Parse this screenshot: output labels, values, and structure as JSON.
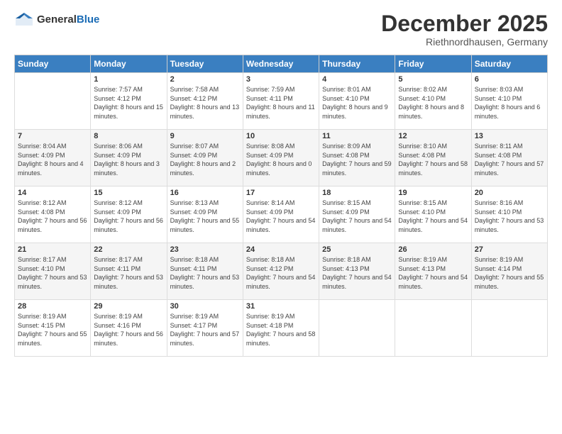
{
  "logo": {
    "general": "General",
    "blue": "Blue"
  },
  "title": "December 2025",
  "subtitle": "Riethnordhausen, Germany",
  "days_header": [
    "Sunday",
    "Monday",
    "Tuesday",
    "Wednesday",
    "Thursday",
    "Friday",
    "Saturday"
  ],
  "weeks": [
    [
      {
        "day": "",
        "sunrise": "",
        "sunset": "",
        "daylight": ""
      },
      {
        "day": "1",
        "sunrise": "Sunrise: 7:57 AM",
        "sunset": "Sunset: 4:12 PM",
        "daylight": "Daylight: 8 hours and 15 minutes."
      },
      {
        "day": "2",
        "sunrise": "Sunrise: 7:58 AM",
        "sunset": "Sunset: 4:12 PM",
        "daylight": "Daylight: 8 hours and 13 minutes."
      },
      {
        "day": "3",
        "sunrise": "Sunrise: 7:59 AM",
        "sunset": "Sunset: 4:11 PM",
        "daylight": "Daylight: 8 hours and 11 minutes."
      },
      {
        "day": "4",
        "sunrise": "Sunrise: 8:01 AM",
        "sunset": "Sunset: 4:10 PM",
        "daylight": "Daylight: 8 hours and 9 minutes."
      },
      {
        "day": "5",
        "sunrise": "Sunrise: 8:02 AM",
        "sunset": "Sunset: 4:10 PM",
        "daylight": "Daylight: 8 hours and 8 minutes."
      },
      {
        "day": "6",
        "sunrise": "Sunrise: 8:03 AM",
        "sunset": "Sunset: 4:10 PM",
        "daylight": "Daylight: 8 hours and 6 minutes."
      }
    ],
    [
      {
        "day": "7",
        "sunrise": "Sunrise: 8:04 AM",
        "sunset": "Sunset: 4:09 PM",
        "daylight": "Daylight: 8 hours and 4 minutes."
      },
      {
        "day": "8",
        "sunrise": "Sunrise: 8:06 AM",
        "sunset": "Sunset: 4:09 PM",
        "daylight": "Daylight: 8 hours and 3 minutes."
      },
      {
        "day": "9",
        "sunrise": "Sunrise: 8:07 AM",
        "sunset": "Sunset: 4:09 PM",
        "daylight": "Daylight: 8 hours and 2 minutes."
      },
      {
        "day": "10",
        "sunrise": "Sunrise: 8:08 AM",
        "sunset": "Sunset: 4:09 PM",
        "daylight": "Daylight: 8 hours and 0 minutes."
      },
      {
        "day": "11",
        "sunrise": "Sunrise: 8:09 AM",
        "sunset": "Sunset: 4:08 PM",
        "daylight": "Daylight: 7 hours and 59 minutes."
      },
      {
        "day": "12",
        "sunrise": "Sunrise: 8:10 AM",
        "sunset": "Sunset: 4:08 PM",
        "daylight": "Daylight: 7 hours and 58 minutes."
      },
      {
        "day": "13",
        "sunrise": "Sunrise: 8:11 AM",
        "sunset": "Sunset: 4:08 PM",
        "daylight": "Daylight: 7 hours and 57 minutes."
      }
    ],
    [
      {
        "day": "14",
        "sunrise": "Sunrise: 8:12 AM",
        "sunset": "Sunset: 4:08 PM",
        "daylight": "Daylight: 7 hours and 56 minutes."
      },
      {
        "day": "15",
        "sunrise": "Sunrise: 8:12 AM",
        "sunset": "Sunset: 4:09 PM",
        "daylight": "Daylight: 7 hours and 56 minutes."
      },
      {
        "day": "16",
        "sunrise": "Sunrise: 8:13 AM",
        "sunset": "Sunset: 4:09 PM",
        "daylight": "Daylight: 7 hours and 55 minutes."
      },
      {
        "day": "17",
        "sunrise": "Sunrise: 8:14 AM",
        "sunset": "Sunset: 4:09 PM",
        "daylight": "Daylight: 7 hours and 54 minutes."
      },
      {
        "day": "18",
        "sunrise": "Sunrise: 8:15 AM",
        "sunset": "Sunset: 4:09 PM",
        "daylight": "Daylight: 7 hours and 54 minutes."
      },
      {
        "day": "19",
        "sunrise": "Sunrise: 8:15 AM",
        "sunset": "Sunset: 4:10 PM",
        "daylight": "Daylight: 7 hours and 54 minutes."
      },
      {
        "day": "20",
        "sunrise": "Sunrise: 8:16 AM",
        "sunset": "Sunset: 4:10 PM",
        "daylight": "Daylight: 7 hours and 53 minutes."
      }
    ],
    [
      {
        "day": "21",
        "sunrise": "Sunrise: 8:17 AM",
        "sunset": "Sunset: 4:10 PM",
        "daylight": "Daylight: 7 hours and 53 minutes."
      },
      {
        "day": "22",
        "sunrise": "Sunrise: 8:17 AM",
        "sunset": "Sunset: 4:11 PM",
        "daylight": "Daylight: 7 hours and 53 minutes."
      },
      {
        "day": "23",
        "sunrise": "Sunrise: 8:18 AM",
        "sunset": "Sunset: 4:11 PM",
        "daylight": "Daylight: 7 hours and 53 minutes."
      },
      {
        "day": "24",
        "sunrise": "Sunrise: 8:18 AM",
        "sunset": "Sunset: 4:12 PM",
        "daylight": "Daylight: 7 hours and 54 minutes."
      },
      {
        "day": "25",
        "sunrise": "Sunrise: 8:18 AM",
        "sunset": "Sunset: 4:13 PM",
        "daylight": "Daylight: 7 hours and 54 minutes."
      },
      {
        "day": "26",
        "sunrise": "Sunrise: 8:19 AM",
        "sunset": "Sunset: 4:13 PM",
        "daylight": "Daylight: 7 hours and 54 minutes."
      },
      {
        "day": "27",
        "sunrise": "Sunrise: 8:19 AM",
        "sunset": "Sunset: 4:14 PM",
        "daylight": "Daylight: 7 hours and 55 minutes."
      }
    ],
    [
      {
        "day": "28",
        "sunrise": "Sunrise: 8:19 AM",
        "sunset": "Sunset: 4:15 PM",
        "daylight": "Daylight: 7 hours and 55 minutes."
      },
      {
        "day": "29",
        "sunrise": "Sunrise: 8:19 AM",
        "sunset": "Sunset: 4:16 PM",
        "daylight": "Daylight: 7 hours and 56 minutes."
      },
      {
        "day": "30",
        "sunrise": "Sunrise: 8:19 AM",
        "sunset": "Sunset: 4:17 PM",
        "daylight": "Daylight: 7 hours and 57 minutes."
      },
      {
        "day": "31",
        "sunrise": "Sunrise: 8:19 AM",
        "sunset": "Sunset: 4:18 PM",
        "daylight": "Daylight: 7 hours and 58 minutes."
      },
      {
        "day": "",
        "sunrise": "",
        "sunset": "",
        "daylight": ""
      },
      {
        "day": "",
        "sunrise": "",
        "sunset": "",
        "daylight": ""
      },
      {
        "day": "",
        "sunrise": "",
        "sunset": "",
        "daylight": ""
      }
    ]
  ]
}
